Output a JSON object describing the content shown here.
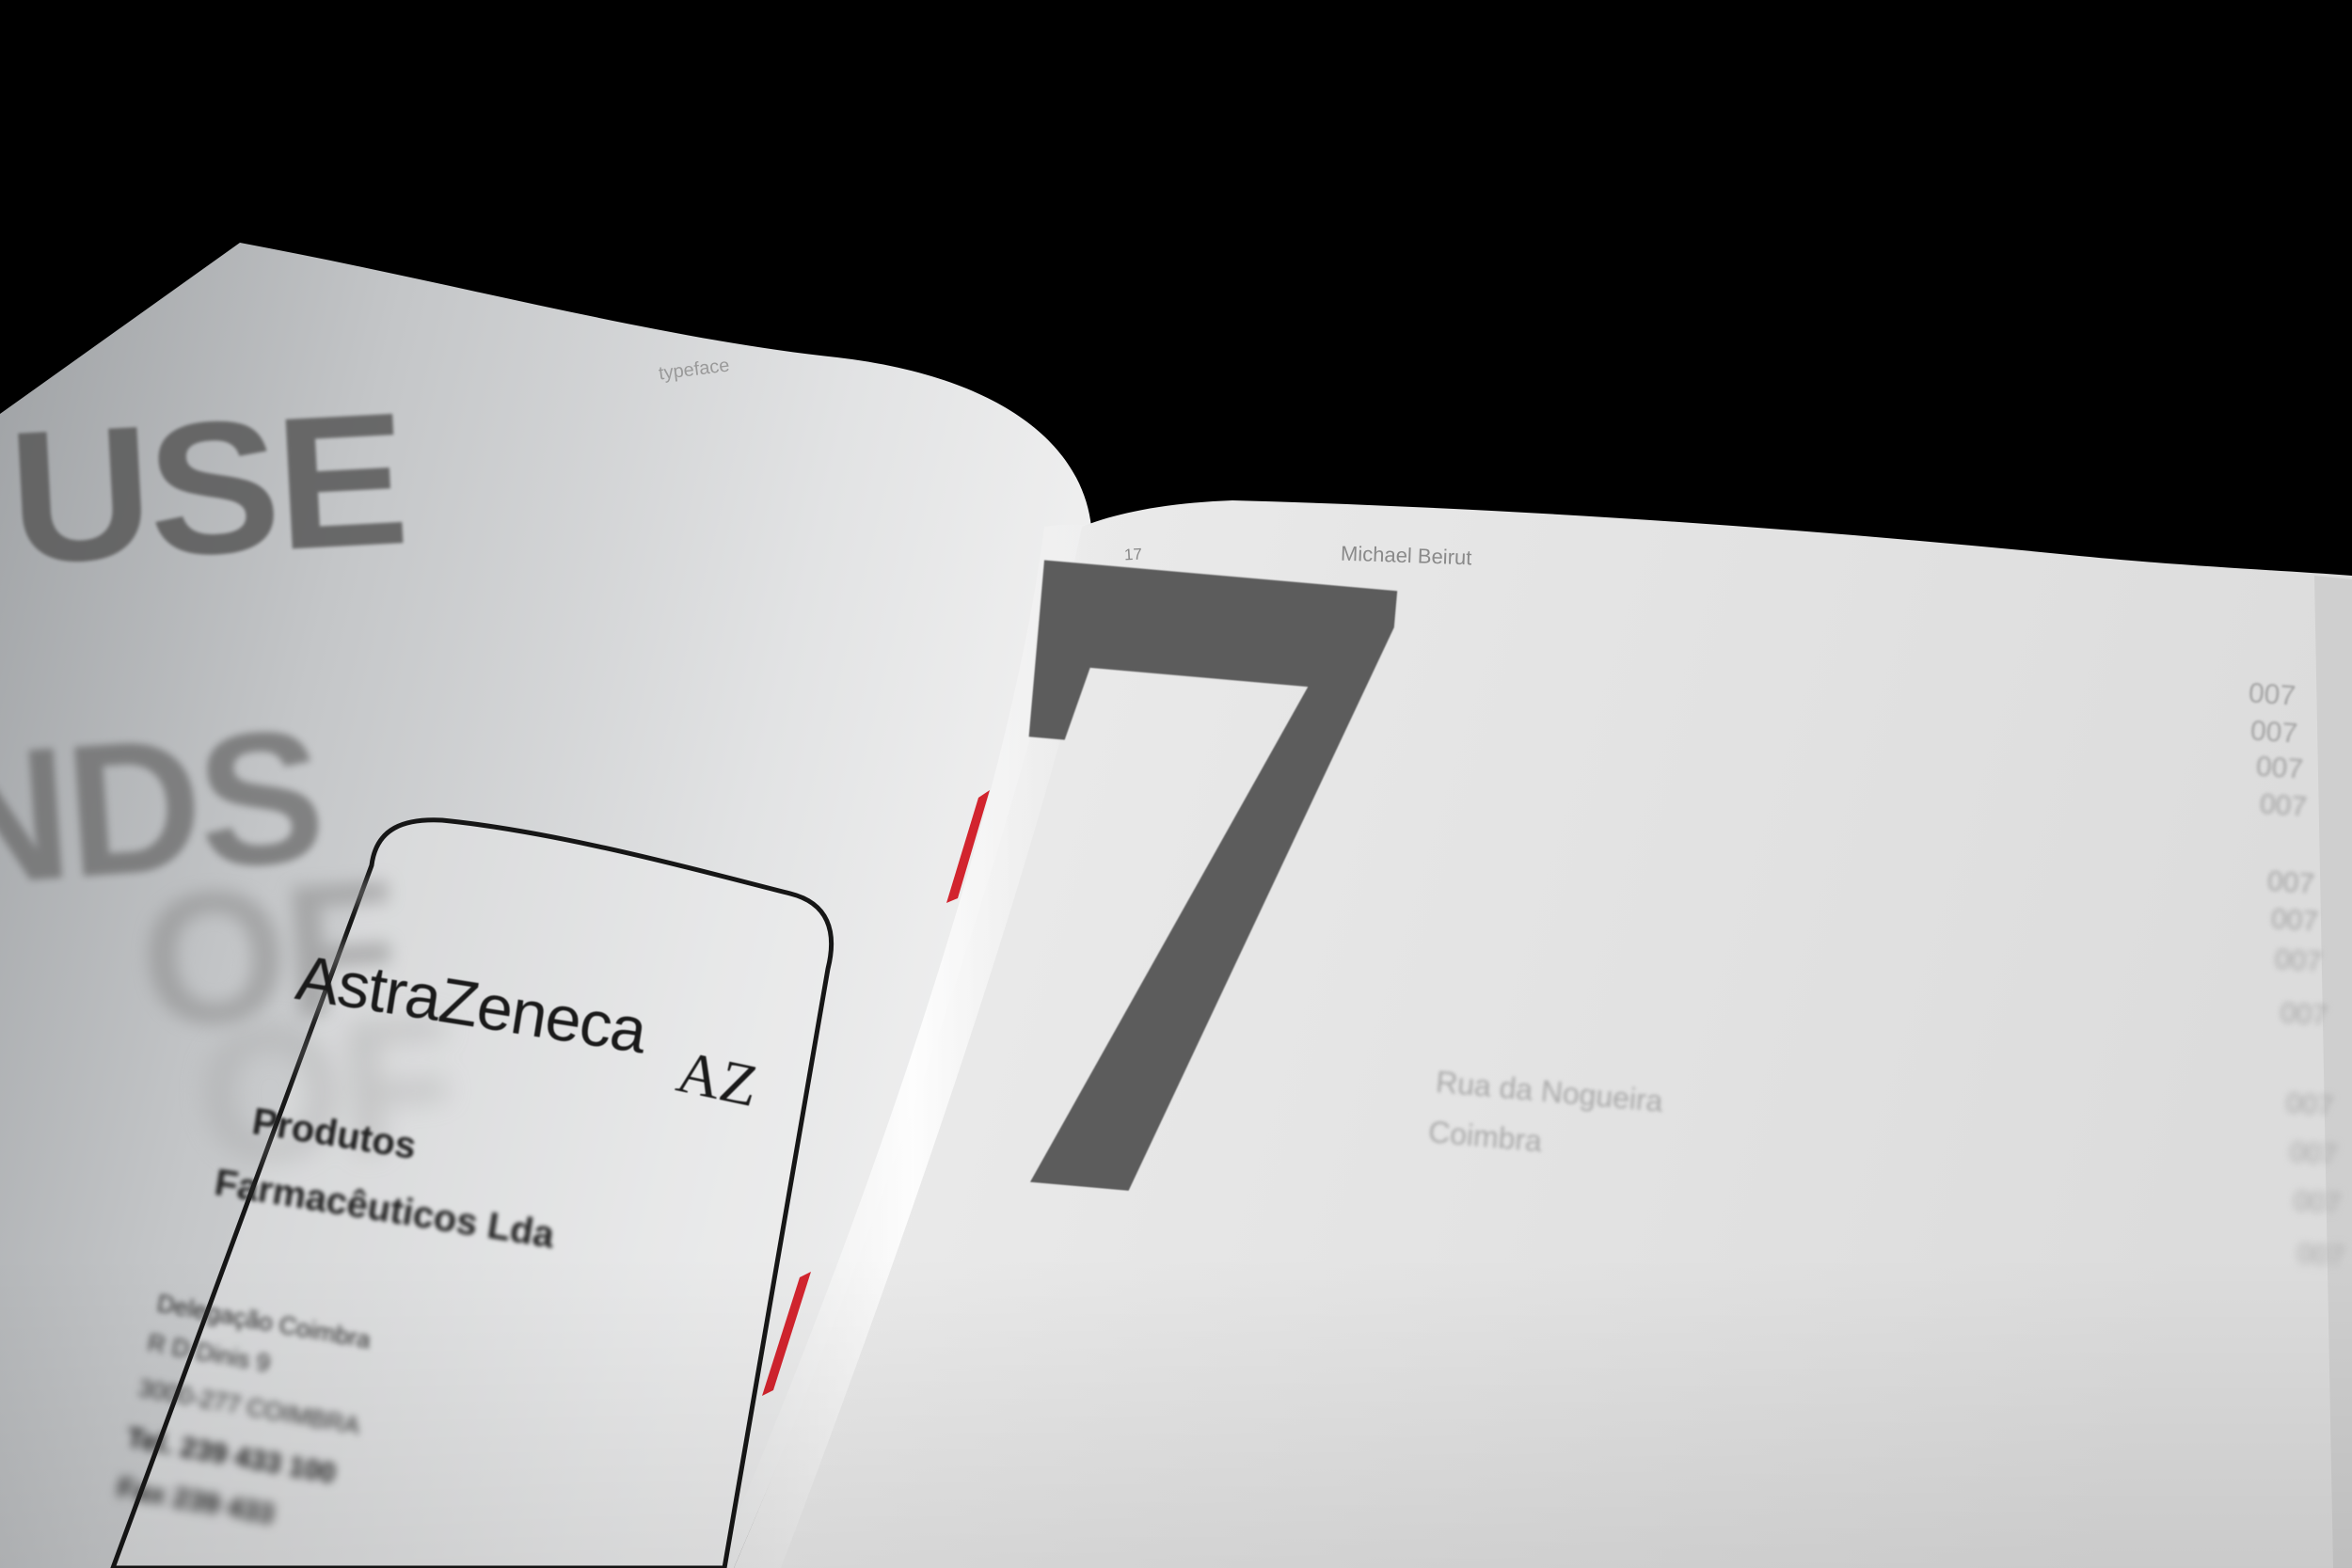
{
  "left_page": {
    "kicker": "typeface",
    "heading_line1": "USE",
    "heading_line2": "NDS",
    "heading_line3": "OF",
    "heading_line4": "OF"
  },
  "business_card": {
    "brand": "AstraZeneca",
    "logo_mark": "AZ",
    "line1": "Produtos",
    "line2": "Farmacêuticos Lda",
    "small_lines": [
      "Delegação Coimbra",
      "R D Dinis 9",
      "3000-277 COIMBRA",
      "Tel. 239 433 100",
      "Fax 239 433"
    ]
  },
  "right_page": {
    "page_number": "17",
    "author": "Michael Beirut",
    "big_numeral": "7",
    "address_line1": "Rua da Nogueira",
    "address_line2": "Coimbra",
    "side_codes": [
      "007",
      "007",
      "007",
      "007",
      "007",
      "007",
      "007",
      "007",
      "007",
      "007",
      "007",
      "007"
    ]
  },
  "colors": {
    "background": "#000000",
    "paper": "#e6e6e6",
    "ink": "#5c5c5c",
    "binding_thread": "#d2242e"
  }
}
